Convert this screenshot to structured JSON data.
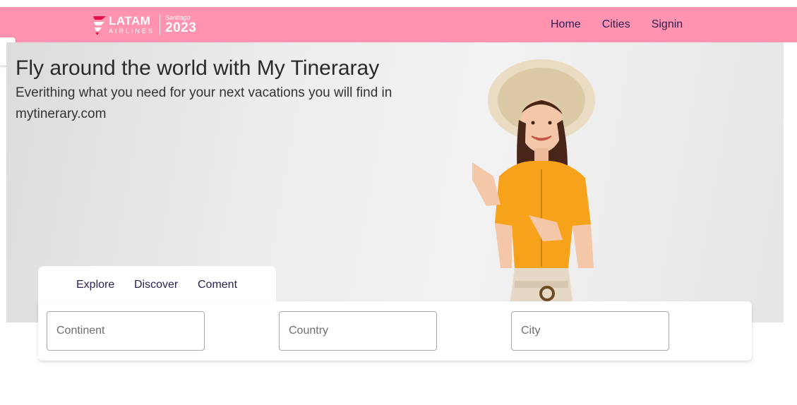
{
  "header": {
    "logo": {
      "brand": "LATAM",
      "sub": "AIRLINES",
      "event_city": "Santiago",
      "event_year": "2023"
    },
    "nav": [
      {
        "label": "Home"
      },
      {
        "label": "Cities"
      },
      {
        "label": "Signin"
      }
    ],
    "background": "#ff93b0"
  },
  "hero": {
    "title": "Fly around the world with My Tineraray",
    "subtitle": "Everithing what you need for your next vacations you will find in mytinerary.com"
  },
  "search": {
    "tabs": [
      {
        "label": "Explore"
      },
      {
        "label": "Discover"
      },
      {
        "label": "Coment"
      }
    ],
    "fields": [
      {
        "placeholder": "Continent",
        "value": ""
      },
      {
        "placeholder": "Country",
        "value": ""
      },
      {
        "placeholder": "City",
        "value": ""
      }
    ]
  },
  "colors": {
    "accent": "#ff93b0",
    "nav_text": "#2d1d52",
    "shirt": "#f7a21b"
  }
}
